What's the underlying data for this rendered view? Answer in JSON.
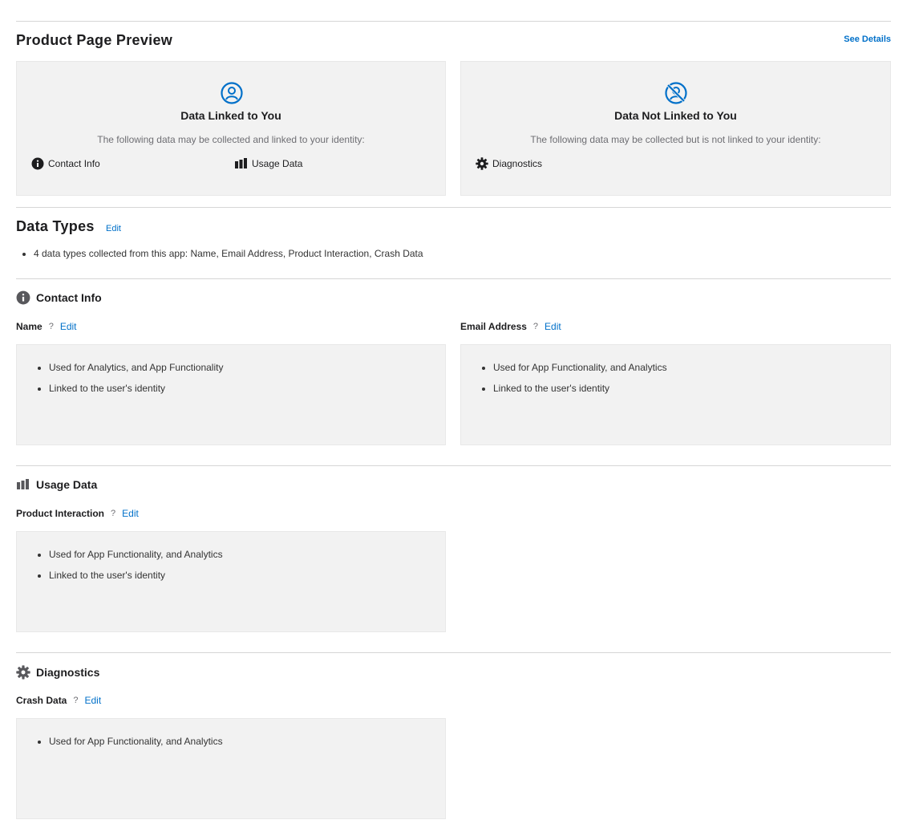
{
  "preview": {
    "title": "Product Page Preview",
    "see_details": "See Details",
    "linked": {
      "title": "Data Linked to You",
      "description": "The following data may be collected and linked to your identity:",
      "icon": "person-circle-icon",
      "categories": [
        {
          "label": "Contact Info",
          "icon": "info-circle-icon"
        },
        {
          "label": "Usage Data",
          "icon": "bar-chart-icon"
        }
      ]
    },
    "not_linked": {
      "title": "Data Not Linked to You",
      "description": "The following data may be collected but is not linked to your identity:",
      "icon": "person-slash-icon",
      "categories": [
        {
          "label": "Diagnostics",
          "icon": "gear-icon"
        }
      ]
    }
  },
  "data_types": {
    "title": "Data Types",
    "edit": "Edit",
    "summary": "4 data types collected from this app: Name, Email Address, Product Interaction, Crash Data"
  },
  "sections": [
    {
      "title": "Contact Info",
      "icon": "info-circle-icon",
      "fields": [
        {
          "name": "Name",
          "help": "?",
          "edit": "Edit",
          "uses": [
            "Used for Analytics, and App Functionality",
            "Linked to the user's identity"
          ]
        },
        {
          "name": "Email Address",
          "help": "?",
          "edit": "Edit",
          "uses": [
            "Used for App Functionality, and Analytics",
            "Linked to the user's identity"
          ]
        }
      ]
    },
    {
      "title": "Usage Data",
      "icon": "bar-chart-icon",
      "fields": [
        {
          "name": "Product Interaction",
          "help": "?",
          "edit": "Edit",
          "uses": [
            "Used for App Functionality, and Analytics",
            "Linked to the user's identity"
          ]
        }
      ]
    },
    {
      "title": "Diagnostics",
      "icon": "gear-icon",
      "fields": [
        {
          "name": "Crash Data",
          "help": "?",
          "edit": "Edit",
          "uses": [
            "Used for App Functionality, and Analytics"
          ]
        }
      ]
    }
  ],
  "colors": {
    "accent": "#0070c9",
    "panel": "#f2f2f2",
    "icon_gray": "#48484a"
  }
}
